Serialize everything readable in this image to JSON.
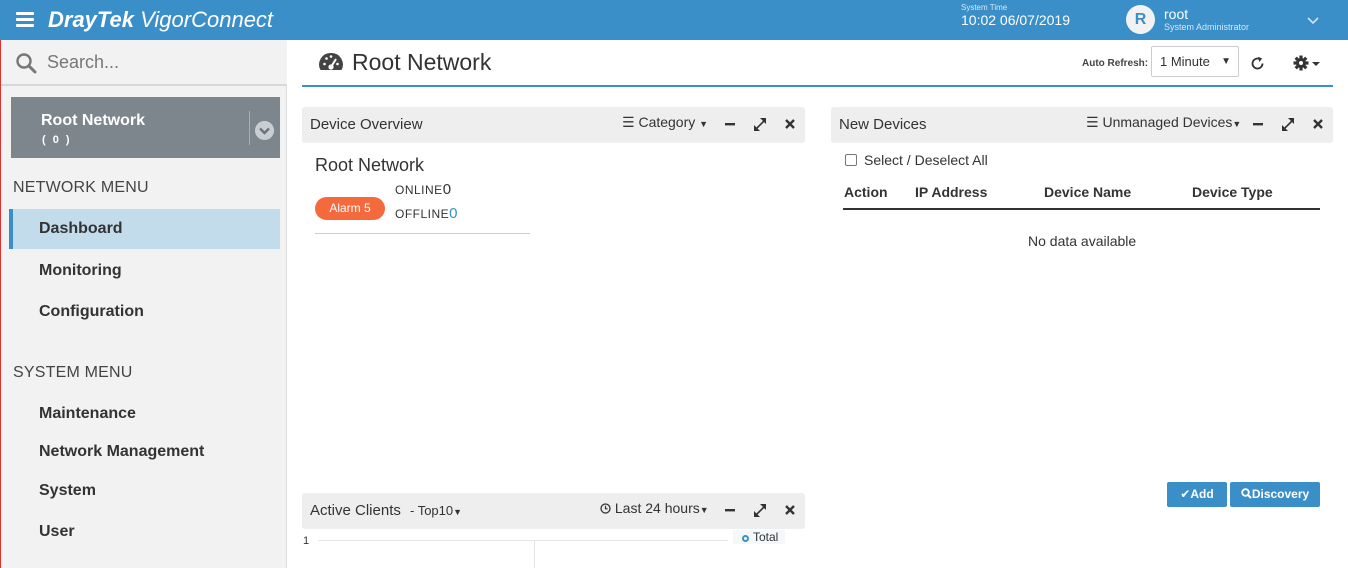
{
  "app": {
    "brand_bold": "DrayTek",
    "brand_light": "VigorConnect"
  },
  "header": {
    "system_time_label": "System Time",
    "system_time": "10:02 06/07/2019",
    "avatar_letter": "R",
    "user_name": "root",
    "user_role": "System Administrator"
  },
  "sidebar": {
    "search_placeholder": "Search...",
    "network": {
      "name": "Root Network",
      "count": "( 0 )"
    },
    "network_menu_title": "NETWORK MENU",
    "network_menu": [
      {
        "label": "Dashboard",
        "active": true
      },
      {
        "label": "Monitoring"
      },
      {
        "label": "Configuration"
      }
    ],
    "system_menu_title": "SYSTEM MENU",
    "system_menu": [
      {
        "label": "Maintenance"
      },
      {
        "label": "Network Management"
      },
      {
        "label": "System"
      },
      {
        "label": "User"
      }
    ]
  },
  "page": {
    "title": "Root Network",
    "auto_refresh_label": "Auto Refresh:",
    "auto_refresh_value": "1 Minute"
  },
  "device_overview": {
    "title": "Device Overview",
    "menu": "Category",
    "network_name": "Root Network",
    "alarm": "Alarm 5",
    "online_label": "ONLINE",
    "online_value": "0",
    "offline_label": "OFFLINE",
    "offline_value": "0"
  },
  "new_devices": {
    "title": "New Devices",
    "menu": "Unmanaged Devices",
    "select_all": "Select / Deselect All",
    "columns": [
      "Action",
      "IP Address",
      "Device Name",
      "Device Type"
    ],
    "empty": "No data available",
    "add_button": "Add",
    "discovery_button": "Discovery"
  },
  "active_clients": {
    "title": "Active Clients",
    "top": "- Top10",
    "range": "Last 24 hours",
    "y_tick": "1",
    "legend": "Total"
  },
  "colors": {
    "header": "#3a8fc9",
    "alarm": "#f46a3d",
    "active_menu": "#c3dceb"
  }
}
